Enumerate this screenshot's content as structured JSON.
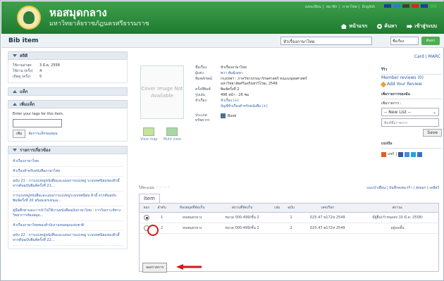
{
  "header": {
    "title": "หอสมุดกลาง",
    "subtitle": "มหาวิทยาลัยราชภัฏนครศรีธรรมราช",
    "toplinks": [
      "ลงทะเบียน",
      "สมาชิก",
      "ภาษาไทย",
      "English"
    ],
    "nav": {
      "home": "หน้าแรก",
      "search": "ค้นหา",
      "login": "เข้าสู่ระบบ"
    },
    "colors": [
      "#1a3ea0",
      "#2a7ad8",
      "#3c3c3c",
      "#e02020",
      "#1a3ea0",
      "#3cb04a"
    ]
  },
  "search": {
    "section_title": "Bib item",
    "value": "หัวเรื่องภาษาไทย",
    "scope": "ชื่อเรื่อง",
    "go_label": "ค้นหา"
  },
  "sidebar": {
    "stats_title": "สถิติ",
    "stats": [
      {
        "k": "ใช้งานล่าสุด",
        "v": "3 มี.ค. 2558"
      },
      {
        "k": "ใช้งาน (ครั้ง)",
        "v": "4"
      },
      {
        "k": "เปิดดู (ครั้ง)",
        "v": "5"
      }
    ],
    "tags_title": "แท็ก",
    "add_tag_title": "เพิ่มแท็ก",
    "tag_prompt": "Enter your tags for this item.",
    "tag_add": "เพิ่ม",
    "tag_manage": "จัดการแท็กของคุณ",
    "related_title": "รายการเกี่ยวข้อง",
    "related": [
      "หัวเรื่องภาษาไทย",
      "หัวเรื่องสำหรับหนังสือภาษาไทย",
      "ฉบับ 21 : การแบ่งหมู่หนังสือและแผนการแบ่งหมู่ ระบบทศนิยมของดิวอี้ จากต้นฉบับพิมพ์ครั้งที่ 21...",
      "การแบ่งหมู่หนังสือและแผนการแบ่งหมู่ระบบทศนิยม ดิวอี้ จากต้นฉบับพิมพ์ครั้งที่ 20 พร้อมเทรเทนเอ...",
      "คู่มือศึกษาและการนำไปใช้งานหนังสือฉบับภาษาไทย : การวิเคราะห์ทางวิทยาการห้องสมุด...",
      "หัวเรื่องภาษาไทยของสำนักงานหอสมุดแห่งชาติ",
      "ฉบับ 22 : การแบ่งหมู่หนังสือและแผนการแบ่งหมู่ ระบบทศนิยมของดิวอี้ จากต้นฉบับพิมพ์ครั้งที่ 22..."
    ]
  },
  "bib": {
    "cover_text": "Cover Image Not Available",
    "map_link": "View map",
    "multi_link": "Multi view",
    "fields": [
      {
        "k": "ชื่อเรื่อง",
        "v": "หัวเรื่องภาษาไทย",
        "link": false
      },
      {
        "k": "ผู้แต่ง",
        "v": "พวา พันธุ์เมฆา",
        "link": true
      },
      {
        "k": "พิมพลักษณ์",
        "v": "กรุงเทพฯ : ภาควิชาบรรณารักษศาสตร์ คณะมนุษยศาสตร์ มหาวิทยาลัยศรีนครินทรวิโรฒ, 2549",
        "link": false
      },
      {
        "k": "ครั้งที่พิมพ์",
        "v": "พิมพ์ครั้งที่ 2",
        "link": false
      },
      {
        "k": "รูปเล่ม",
        "v": "496 หน้า : 26 ซม",
        "link": false
      },
      {
        "k": "หัวเรื่อง",
        "v": "หัวเรื่อง (+)",
        "link": true
      },
      {
        "k": "",
        "v": "บัญชีหัวเรื่องสำหรับหนังสือ (+)",
        "link": true
      },
      {
        "k": "ประเภททรัพยากร",
        "v": "Book",
        "link": false
      }
    ]
  },
  "right": {
    "card_marc": "Card | MARC",
    "review_title": "รีวิว",
    "member_reviews": "Member reviews (0)",
    "add_review": "Add Your Review",
    "mylist_title": "เพิ่มรายการของฉัน",
    "add_to_label": "เพิ่มรายการ :",
    "new_list": "-- New List --",
    "list_placeholder": "พิมพ์ชื่อรายการ",
    "save": "Save",
    "share_title": "แบ่งปัน",
    "share_label": "แชร์"
  },
  "rating": {
    "label": "ให้คะแนน",
    "links": "แนะนำเพื่อน | บันทึกลงตะกร้า | ส่งออก | เคลียร์"
  },
  "items": {
    "tab": "Item",
    "headers": [
      "จอง",
      "ลำดับ",
      "ห้องสมุดที่จัดเก็บ",
      "สถานที่จัดเก็บ",
      "เล่ม",
      "ฉบับ",
      "เลขเรียก",
      "สถานะ"
    ],
    "rows": [
      {
        "selected": true,
        "seq": "1",
        "library": "หอสมุดกลาง",
        "location": "หมวด 000-499/ชั้น 2",
        "vol": "",
        "copy": "1",
        "call": "025.47 พ172ห 2549",
        "status": "มีผู้ยืม(กำหนดส่ง 10 มี.ค. 2558)"
      },
      {
        "selected": false,
        "seq": "2",
        "library": "หอสมุดกลาง",
        "location": "หมวด 000-499/ชั้น 2",
        "vol": "",
        "copy": "2",
        "call": "025.47 พ172ห 2549",
        "status": "อยู่บนชั้น"
      }
    ],
    "reserve": "จองรายการ"
  }
}
